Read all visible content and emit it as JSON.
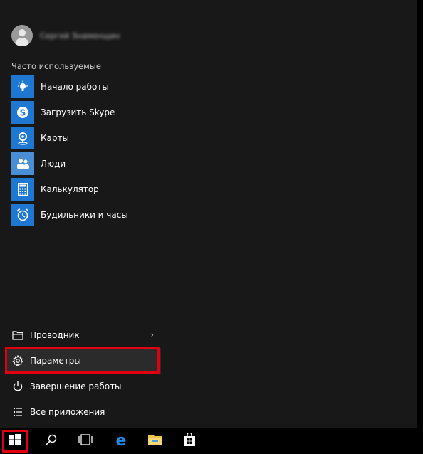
{
  "user": {
    "name": "Сергей Знаменщин"
  },
  "section_title": "Часто используемые",
  "apps": [
    {
      "label": "Начало работы",
      "icon": "lightbulb-icon"
    },
    {
      "label": "Загрузить Skype",
      "icon": "skype-icon"
    },
    {
      "label": "Карты",
      "icon": "map-pin-icon"
    },
    {
      "label": "Люди",
      "icon": "people-icon"
    },
    {
      "label": "Калькулятор",
      "icon": "calculator-icon"
    },
    {
      "label": "Будильники и часы",
      "icon": "alarm-clock-icon"
    }
  ],
  "bottom": {
    "explorer": "Проводник",
    "settings": "Параметры",
    "shutdown": "Завершение работы",
    "all_apps": "Все приложения"
  },
  "taskbar": {
    "items": [
      "start-icon",
      "search-icon",
      "task-view-icon",
      "edge-icon",
      "file-explorer-icon",
      "store-icon"
    ]
  },
  "colors": {
    "tile": "#1e78d2",
    "highlight": "#e0000f",
    "menu_bg": "#181818"
  }
}
